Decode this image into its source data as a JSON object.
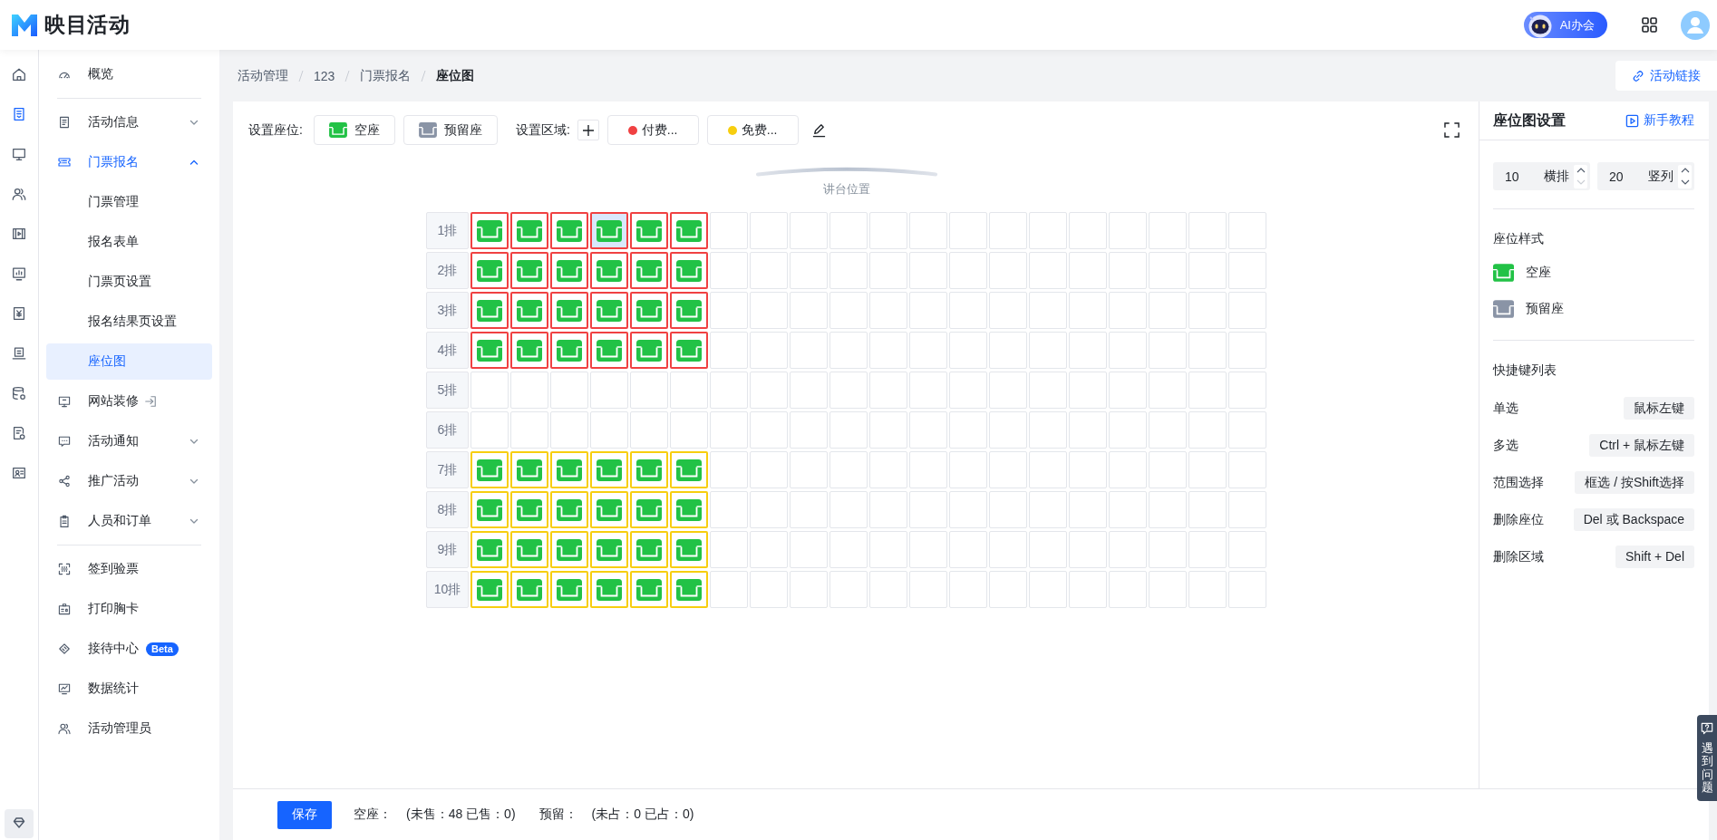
{
  "header": {
    "app_name": "映目活动",
    "ai_button": "AI办会"
  },
  "rail": [
    {
      "selected": false
    },
    {
      "selected": true
    },
    {
      "selected": false
    },
    {
      "selected": false
    },
    {
      "selected": false
    },
    {
      "selected": false
    },
    {
      "selected": false
    },
    {
      "selected": false
    },
    {
      "selected": false
    },
    {
      "selected": false
    },
    {
      "selected": false
    }
  ],
  "sidebar": {
    "groups": [
      [
        {
          "label": "概览",
          "selected": false
        }
      ],
      [
        {
          "label": "活动信息",
          "selected": false,
          "expanded": false
        },
        {
          "label": "门票报名",
          "selected": false,
          "expanded": true,
          "children": [
            {
              "label": "门票管理",
              "selected": false
            },
            {
              "label": "报名表单",
              "selected": false
            },
            {
              "label": "门票页设置",
              "selected": false
            },
            {
              "label": "报名结果页设置",
              "selected": false
            },
            {
              "label": "座位图",
              "selected": true
            }
          ]
        },
        {
          "label": "网站装修",
          "selected": false,
          "external": true
        },
        {
          "label": "活动通知",
          "selected": false,
          "expanded": false
        },
        {
          "label": "推广活动",
          "selected": false,
          "expanded": false
        },
        {
          "label": "人员和订单",
          "selected": false,
          "expanded": false
        }
      ],
      [
        {
          "label": "签到验票",
          "selected": false
        },
        {
          "label": "打印胸卡",
          "selected": false
        },
        {
          "label": "接待中心",
          "selected": false,
          "badge": "Beta"
        },
        {
          "label": "数据统计",
          "selected": false
        },
        {
          "label": "活动管理员",
          "selected": false
        }
      ]
    ]
  },
  "breadcrumb": [
    "活动管理",
    "123",
    "门票报名",
    "座位图"
  ],
  "link_button": "活动链接",
  "toolbar": {
    "seat_label": "设置座位:",
    "seat_types": [
      {
        "label": "空座",
        "kind": "vacant"
      },
      {
        "label": "预留座",
        "kind": "reserved"
      }
    ],
    "area_label": "设置区域:",
    "areas": [
      {
        "label": "付费...",
        "color": "#f04142"
      },
      {
        "label": "免费...",
        "color": "#f7ce0f"
      }
    ]
  },
  "stage": {
    "label": "讲台位置"
  },
  "grid": {
    "rows": [
      {
        "label": "1排",
        "cells": [
          {
            "kind": "vacant",
            "color": "#f04142",
            "selected": false
          },
          {
            "kind": "vacant",
            "color": "#f04142",
            "selected": false
          },
          {
            "kind": "vacant",
            "color": "#f04142",
            "selected": false
          },
          {
            "kind": "vacant",
            "color": "#f04142",
            "selected": true
          },
          {
            "kind": "vacant",
            "color": "#f04142",
            "selected": false
          },
          {
            "kind": "vacant",
            "color": "#f04142",
            "selected": false
          },
          {
            "kind": "blank",
            "selected": false
          },
          {
            "kind": "blank",
            "selected": false
          },
          {
            "kind": "blank",
            "selected": false
          },
          {
            "kind": "blank",
            "selected": false
          },
          {
            "kind": "blank",
            "selected": false
          },
          {
            "kind": "blank",
            "selected": false
          },
          {
            "kind": "blank",
            "selected": false
          },
          {
            "kind": "blank",
            "selected": false
          },
          {
            "kind": "blank",
            "selected": false
          },
          {
            "kind": "blank",
            "selected": false
          },
          {
            "kind": "blank",
            "selected": false
          },
          {
            "kind": "blank",
            "selected": false
          },
          {
            "kind": "blank",
            "selected": false
          },
          {
            "kind": "blank",
            "selected": false
          }
        ]
      },
      {
        "label": "2排",
        "cells": [
          {
            "kind": "vacant",
            "color": "#f04142",
            "selected": false
          },
          {
            "kind": "vacant",
            "color": "#f04142",
            "selected": false
          },
          {
            "kind": "vacant",
            "color": "#f04142",
            "selected": false
          },
          {
            "kind": "vacant",
            "color": "#f04142",
            "selected": false
          },
          {
            "kind": "vacant",
            "color": "#f04142",
            "selected": false
          },
          {
            "kind": "vacant",
            "color": "#f04142",
            "selected": false
          },
          {
            "kind": "blank",
            "selected": false
          },
          {
            "kind": "blank",
            "selected": false
          },
          {
            "kind": "blank",
            "selected": false
          },
          {
            "kind": "blank",
            "selected": false
          },
          {
            "kind": "blank",
            "selected": false
          },
          {
            "kind": "blank",
            "selected": false
          },
          {
            "kind": "blank",
            "selected": false
          },
          {
            "kind": "blank",
            "selected": false
          },
          {
            "kind": "blank",
            "selected": false
          },
          {
            "kind": "blank",
            "selected": false
          },
          {
            "kind": "blank",
            "selected": false
          },
          {
            "kind": "blank",
            "selected": false
          },
          {
            "kind": "blank",
            "selected": false
          },
          {
            "kind": "blank",
            "selected": false
          }
        ]
      },
      {
        "label": "3排",
        "cells": [
          {
            "kind": "vacant",
            "color": "#f04142",
            "selected": false
          },
          {
            "kind": "vacant",
            "color": "#f04142",
            "selected": false
          },
          {
            "kind": "vacant",
            "color": "#f04142",
            "selected": false
          },
          {
            "kind": "vacant",
            "color": "#f04142",
            "selected": false
          },
          {
            "kind": "vacant",
            "color": "#f04142",
            "selected": false
          },
          {
            "kind": "vacant",
            "color": "#f04142",
            "selected": false
          },
          {
            "kind": "blank",
            "selected": false
          },
          {
            "kind": "blank",
            "selected": false
          },
          {
            "kind": "blank",
            "selected": false
          },
          {
            "kind": "blank",
            "selected": false
          },
          {
            "kind": "blank",
            "selected": false
          },
          {
            "kind": "blank",
            "selected": false
          },
          {
            "kind": "blank",
            "selected": false
          },
          {
            "kind": "blank",
            "selected": false
          },
          {
            "kind": "blank",
            "selected": false
          },
          {
            "kind": "blank",
            "selected": false
          },
          {
            "kind": "blank",
            "selected": false
          },
          {
            "kind": "blank",
            "selected": false
          },
          {
            "kind": "blank",
            "selected": false
          },
          {
            "kind": "blank",
            "selected": false
          }
        ]
      },
      {
        "label": "4排",
        "cells": [
          {
            "kind": "vacant",
            "color": "#f04142",
            "selected": false
          },
          {
            "kind": "vacant",
            "color": "#f04142",
            "selected": false
          },
          {
            "kind": "vacant",
            "color": "#f04142",
            "selected": false
          },
          {
            "kind": "vacant",
            "color": "#f04142",
            "selected": false
          },
          {
            "kind": "vacant",
            "color": "#f04142",
            "selected": false
          },
          {
            "kind": "vacant",
            "color": "#f04142",
            "selected": false
          },
          {
            "kind": "blank",
            "selected": false
          },
          {
            "kind": "blank",
            "selected": false
          },
          {
            "kind": "blank",
            "selected": false
          },
          {
            "kind": "blank",
            "selected": false
          },
          {
            "kind": "blank",
            "selected": false
          },
          {
            "kind": "blank",
            "selected": false
          },
          {
            "kind": "blank",
            "selected": false
          },
          {
            "kind": "blank",
            "selected": false
          },
          {
            "kind": "blank",
            "selected": false
          },
          {
            "kind": "blank",
            "selected": false
          },
          {
            "kind": "blank",
            "selected": false
          },
          {
            "kind": "blank",
            "selected": false
          },
          {
            "kind": "blank",
            "selected": false
          },
          {
            "kind": "blank",
            "selected": false
          }
        ]
      },
      {
        "label": "5排",
        "cells": [
          {
            "kind": "blank",
            "selected": false
          },
          {
            "kind": "blank",
            "selected": false
          },
          {
            "kind": "blank",
            "selected": false
          },
          {
            "kind": "blank",
            "selected": false
          },
          {
            "kind": "blank",
            "selected": false
          },
          {
            "kind": "blank",
            "selected": false
          },
          {
            "kind": "blank",
            "selected": false
          },
          {
            "kind": "blank",
            "selected": false
          },
          {
            "kind": "blank",
            "selected": false
          },
          {
            "kind": "blank",
            "selected": false
          },
          {
            "kind": "blank",
            "selected": false
          },
          {
            "kind": "blank",
            "selected": false
          },
          {
            "kind": "blank",
            "selected": false
          },
          {
            "kind": "blank",
            "selected": false
          },
          {
            "kind": "blank",
            "selected": false
          },
          {
            "kind": "blank",
            "selected": false
          },
          {
            "kind": "blank",
            "selected": false
          },
          {
            "kind": "blank",
            "selected": false
          },
          {
            "kind": "blank",
            "selected": false
          },
          {
            "kind": "blank",
            "selected": false
          }
        ]
      },
      {
        "label": "6排",
        "cells": [
          {
            "kind": "blank",
            "selected": false
          },
          {
            "kind": "blank",
            "selected": false
          },
          {
            "kind": "blank",
            "selected": false
          },
          {
            "kind": "blank",
            "selected": false
          },
          {
            "kind": "blank",
            "selected": false
          },
          {
            "kind": "blank",
            "selected": false
          },
          {
            "kind": "blank",
            "selected": false
          },
          {
            "kind": "blank",
            "selected": false
          },
          {
            "kind": "blank",
            "selected": false
          },
          {
            "kind": "blank",
            "selected": false
          },
          {
            "kind": "blank",
            "selected": false
          },
          {
            "kind": "blank",
            "selected": false
          },
          {
            "kind": "blank",
            "selected": false
          },
          {
            "kind": "blank",
            "selected": false
          },
          {
            "kind": "blank",
            "selected": false
          },
          {
            "kind": "blank",
            "selected": false
          },
          {
            "kind": "blank",
            "selected": false
          },
          {
            "kind": "blank",
            "selected": false
          },
          {
            "kind": "blank",
            "selected": false
          },
          {
            "kind": "blank",
            "selected": false
          }
        ]
      },
      {
        "label": "7排",
        "cells": [
          {
            "kind": "vacant",
            "color": "#f7ce0f",
            "selected": false
          },
          {
            "kind": "vacant",
            "color": "#f7ce0f",
            "selected": false
          },
          {
            "kind": "vacant",
            "color": "#f7ce0f",
            "selected": false
          },
          {
            "kind": "vacant",
            "color": "#f7ce0f",
            "selected": false
          },
          {
            "kind": "vacant",
            "color": "#f7ce0f",
            "selected": false
          },
          {
            "kind": "vacant",
            "color": "#f7ce0f",
            "selected": false
          },
          {
            "kind": "blank",
            "selected": false
          },
          {
            "kind": "blank",
            "selected": false
          },
          {
            "kind": "blank",
            "selected": false
          },
          {
            "kind": "blank",
            "selected": false
          },
          {
            "kind": "blank",
            "selected": false
          },
          {
            "kind": "blank",
            "selected": false
          },
          {
            "kind": "blank",
            "selected": false
          },
          {
            "kind": "blank",
            "selected": false
          },
          {
            "kind": "blank",
            "selected": false
          },
          {
            "kind": "blank",
            "selected": false
          },
          {
            "kind": "blank",
            "selected": false
          },
          {
            "kind": "blank",
            "selected": false
          },
          {
            "kind": "blank",
            "selected": false
          },
          {
            "kind": "blank",
            "selected": false
          }
        ]
      },
      {
        "label": "8排",
        "cells": [
          {
            "kind": "vacant",
            "color": "#f7ce0f",
            "selected": false
          },
          {
            "kind": "vacant",
            "color": "#f7ce0f",
            "selected": false
          },
          {
            "kind": "vacant",
            "color": "#f7ce0f",
            "selected": false
          },
          {
            "kind": "vacant",
            "color": "#f7ce0f",
            "selected": false
          },
          {
            "kind": "vacant",
            "color": "#f7ce0f",
            "selected": false
          },
          {
            "kind": "vacant",
            "color": "#f7ce0f",
            "selected": false
          },
          {
            "kind": "blank",
            "selected": false
          },
          {
            "kind": "blank",
            "selected": false
          },
          {
            "kind": "blank",
            "selected": false
          },
          {
            "kind": "blank",
            "selected": false
          },
          {
            "kind": "blank",
            "selected": false
          },
          {
            "kind": "blank",
            "selected": false
          },
          {
            "kind": "blank",
            "selected": false
          },
          {
            "kind": "blank",
            "selected": false
          },
          {
            "kind": "blank",
            "selected": false
          },
          {
            "kind": "blank",
            "selected": false
          },
          {
            "kind": "blank",
            "selected": false
          },
          {
            "kind": "blank",
            "selected": false
          },
          {
            "kind": "blank",
            "selected": false
          },
          {
            "kind": "blank",
            "selected": false
          }
        ]
      },
      {
        "label": "9排",
        "cells": [
          {
            "kind": "vacant",
            "color": "#f7ce0f",
            "selected": false
          },
          {
            "kind": "vacant",
            "color": "#f7ce0f",
            "selected": false
          },
          {
            "kind": "vacant",
            "color": "#f7ce0f",
            "selected": false
          },
          {
            "kind": "vacant",
            "color": "#f7ce0f",
            "selected": false
          },
          {
            "kind": "vacant",
            "color": "#f7ce0f",
            "selected": false
          },
          {
            "kind": "vacant",
            "color": "#f7ce0f",
            "selected": false
          },
          {
            "kind": "blank",
            "selected": false
          },
          {
            "kind": "blank",
            "selected": false
          },
          {
            "kind": "blank",
            "selected": false
          },
          {
            "kind": "blank",
            "selected": false
          },
          {
            "kind": "blank",
            "selected": false
          },
          {
            "kind": "blank",
            "selected": false
          },
          {
            "kind": "blank",
            "selected": false
          },
          {
            "kind": "blank",
            "selected": false
          },
          {
            "kind": "blank",
            "selected": false
          },
          {
            "kind": "blank",
            "selected": false
          },
          {
            "kind": "blank",
            "selected": false
          },
          {
            "kind": "blank",
            "selected": false
          },
          {
            "kind": "blank",
            "selected": false
          },
          {
            "kind": "blank",
            "selected": false
          }
        ]
      },
      {
        "label": "10排",
        "cells": [
          {
            "kind": "vacant",
            "color": "#f7ce0f",
            "selected": false
          },
          {
            "kind": "vacant",
            "color": "#f7ce0f",
            "selected": false
          },
          {
            "kind": "vacant",
            "color": "#f7ce0f",
            "selected": false
          },
          {
            "kind": "vacant",
            "color": "#f7ce0f",
            "selected": false
          },
          {
            "kind": "vacant",
            "color": "#f7ce0f",
            "selected": false
          },
          {
            "kind": "vacant",
            "color": "#f7ce0f",
            "selected": false
          },
          {
            "kind": "blank",
            "selected": false
          },
          {
            "kind": "blank",
            "selected": false
          },
          {
            "kind": "blank",
            "selected": false
          },
          {
            "kind": "blank",
            "selected": false
          },
          {
            "kind": "blank",
            "selected": false
          },
          {
            "kind": "blank",
            "selected": false
          },
          {
            "kind": "blank",
            "selected": false
          },
          {
            "kind": "blank",
            "selected": false
          },
          {
            "kind": "blank",
            "selected": false
          },
          {
            "kind": "blank",
            "selected": false
          },
          {
            "kind": "blank",
            "selected": false
          },
          {
            "kind": "blank",
            "selected": false
          },
          {
            "kind": "blank",
            "selected": false
          },
          {
            "kind": "blank",
            "selected": false
          }
        ]
      }
    ]
  },
  "panel": {
    "title": "座位图设置",
    "tutorial_link": "新手教程",
    "fields": [
      {
        "value": "10",
        "unit": "横排",
        "decrease_disabled": true
      },
      {
        "value": "20",
        "unit": "竖列",
        "decrease_disabled": false
      }
    ],
    "style_heading": "座位样式",
    "styles": [
      {
        "label": "空座",
        "kind": "vacant"
      },
      {
        "label": "预留座",
        "kind": "reserved"
      }
    ],
    "shortcut_heading": "快捷键列表",
    "shortcuts": [
      {
        "action": "单选",
        "keys": "鼠标左键"
      },
      {
        "action": "多选",
        "keys": "Ctrl + 鼠标左键"
      },
      {
        "action": "范围选择",
        "keys": "框选 / 按Shift选择"
      },
      {
        "action": "删除座位",
        "keys": "Del 或 Backspace"
      },
      {
        "action": "删除区域",
        "keys": "Shift + Del"
      }
    ]
  },
  "footer": {
    "save_button": "保存",
    "stats": [
      {
        "label": "空座：",
        "value": "(未售：48 已售：0)"
      },
      {
        "label": "预留：",
        "value": "(未占：0 已占：0)"
      }
    ]
  },
  "feedback": {
    "label": "遇到问题"
  }
}
